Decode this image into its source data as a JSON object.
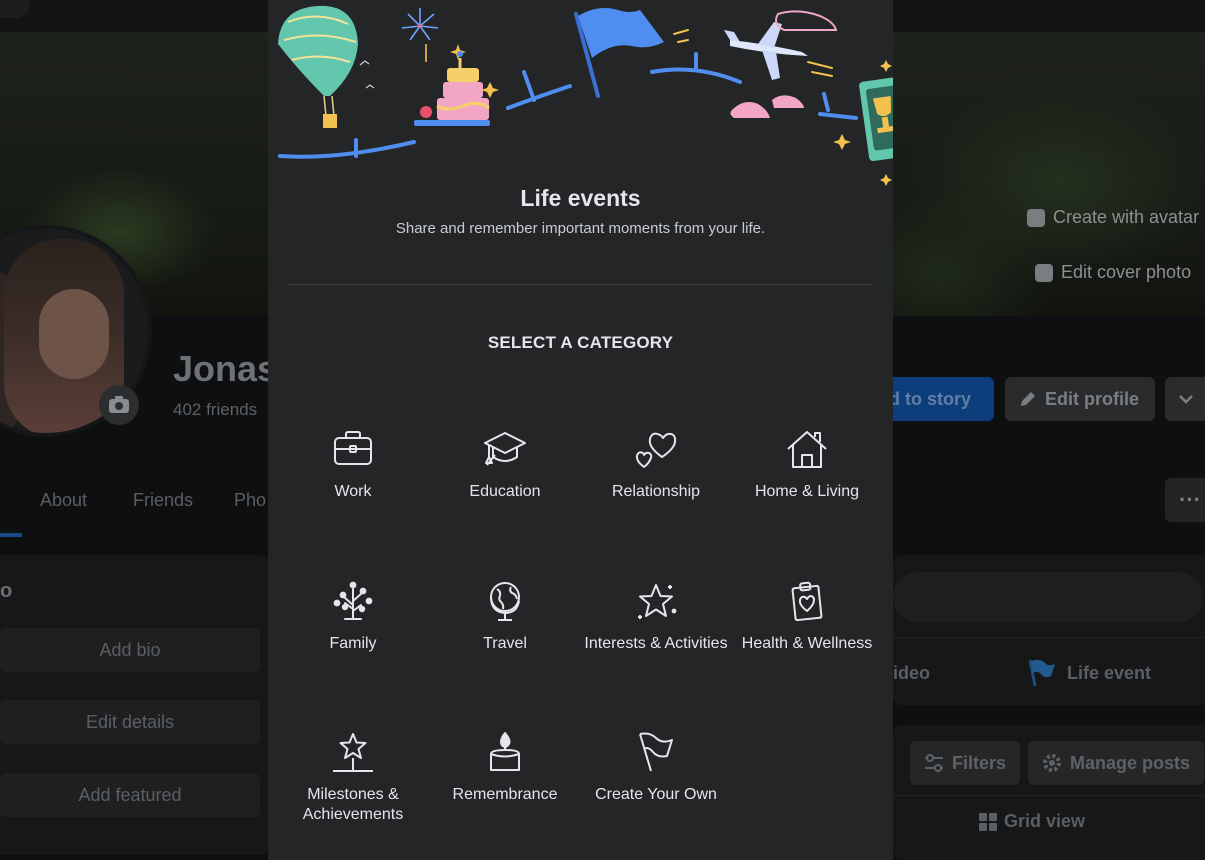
{
  "background": {
    "cover_buttons": [
      {
        "label": "Create with avatar",
        "icon": "avatar-icon"
      },
      {
        "label": "Edit cover photo",
        "icon": "camera-icon"
      }
    ],
    "profile_name": "Jonas",
    "friends_count": "402 friends",
    "actions": {
      "add_story": "ld to story",
      "edit_profile": "Edit profile"
    },
    "tabs": [
      "About",
      "Friends",
      "Pho"
    ],
    "intro_heading": "o",
    "left_buttons": [
      "Add bio",
      "Edit details",
      "Add featured"
    ],
    "composer": {
      "video_label": "ideo",
      "life_event_label": "Life event"
    },
    "posts_toolbar": {
      "filters": "Filters",
      "manage_posts": "Manage posts",
      "grid_view": "Grid view"
    },
    "colors": {
      "accent": "#1b74e4",
      "accent_dim": "#0d3d7a"
    }
  },
  "modal": {
    "title": "Life events",
    "subtitle": "Share and remember important moments from your life.",
    "category_heading": "SELECT A CATEGORY",
    "categories": [
      {
        "label": "Work",
        "icon": "briefcase-icon"
      },
      {
        "label": "Education",
        "icon": "graduation-cap-icon"
      },
      {
        "label": "Relationship",
        "icon": "hearts-icon"
      },
      {
        "label": "Home & Living",
        "icon": "house-icon"
      },
      {
        "label": "Family",
        "icon": "tree-icon"
      },
      {
        "label": "Travel",
        "icon": "globe-icon"
      },
      {
        "label": "Interests & Activities",
        "icon": "sparkle-star-icon"
      },
      {
        "label": "Health & Wellness",
        "icon": "clipboard-heart-icon"
      },
      {
        "label": "Milestones & Achievements",
        "icon": "star-trophy-icon"
      },
      {
        "label": "Remembrance",
        "icon": "candle-icon"
      },
      {
        "label": "Create Your Own",
        "icon": "flag-icon"
      }
    ],
    "colors": {
      "surface": "#242526",
      "text": "#e4e6eb",
      "divider": "#3e4042"
    }
  }
}
